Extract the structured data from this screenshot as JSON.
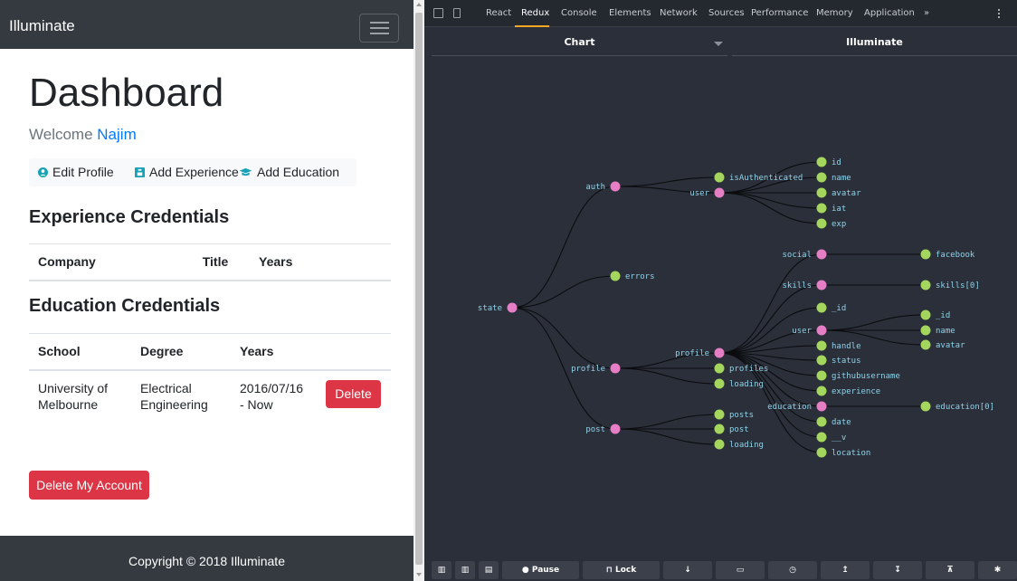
{
  "app": {
    "brand": "Illuminate",
    "title": "Dashboard",
    "welcome_prefix": "Welcome",
    "user_name": "Najim",
    "actions": [
      {
        "label": "Edit Profile",
        "icon": "user-circle-icon"
      },
      {
        "label": "Add Experience",
        "icon": "id-badge-icon"
      },
      {
        "label": "Add Education",
        "icon": "graduation-cap-icon"
      }
    ],
    "experience": {
      "title": "Experience Credentials",
      "columns": [
        "Company",
        "Title",
        "Years"
      ]
    },
    "education": {
      "title": "Education Credentials",
      "columns": [
        "School",
        "Degree",
        "Years"
      ],
      "rows": [
        {
          "school": "University of Melbourne",
          "degree": "Electrical Engineering",
          "years": "2016/07/16 - Now",
          "action": "Delete"
        }
      ]
    },
    "delete_account": "Delete My Account",
    "footer": "Copyright © 2018 Illuminate"
  },
  "devtools": {
    "tabs": [
      "React",
      "Redux",
      "Console",
      "Elements",
      "Network",
      "Sources",
      "Performance",
      "Memory",
      "Application",
      "»"
    ],
    "active_tab": "Redux",
    "monitor": "Chart",
    "instance": "Illuminate",
    "tree_labels": {
      "root": "state",
      "auth": "auth",
      "errors": "errors",
      "profile": "profile",
      "post": "post",
      "isAuthenticated": "isAuthenticated",
      "auth_user": "user",
      "id": "id",
      "name": "name",
      "avatar": "avatar",
      "iat": "iat",
      "exp": "exp",
      "profile_profile": "profile",
      "profiles": "profiles",
      "profile_loading": "loading",
      "social": "social",
      "skills": "skills",
      "_id": "_id",
      "pp_user": "user",
      "handle": "handle",
      "status": "status",
      "githubusername": "githubusername",
      "experience": "experience",
      "education": "education",
      "date": "date",
      "__v": "__v",
      "location": "location",
      "facebook": "facebook",
      "skills0": "skills[0]",
      "u_id": "_id",
      "u_name": "name",
      "u_avatar": "avatar",
      "education0": "education[0]",
      "posts": "posts",
      "post_post": "post",
      "post_loading": "loading"
    },
    "colors": {
      "branch_node": "#e67ec5",
      "leaf_node": "#a4d65e",
      "label": "#8fd3ea",
      "link": "#0b0c0e"
    },
    "bottom_buttons": [
      "Pause",
      "Lock"
    ]
  }
}
